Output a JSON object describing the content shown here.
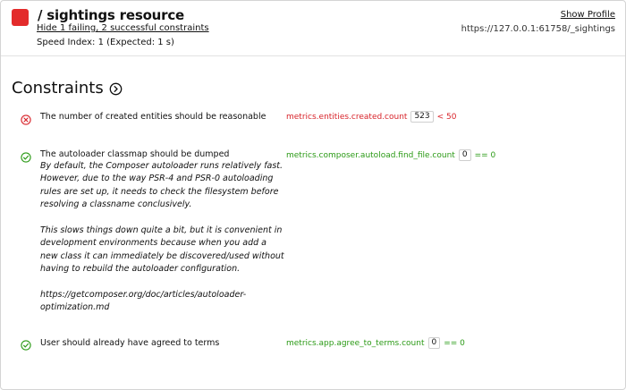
{
  "header": {
    "title": "/ sightings resource",
    "summary_link": "Hide 1 failing, 2 successful constraints",
    "speed_index": "Speed Index: 1 (Expected: 1 s)",
    "show_profile": "Show Profile",
    "url": "https://127.0.0.1:61758/_sightings",
    "status_color": "#e32b2b"
  },
  "section": {
    "title": "Constraints",
    "icon": "arrow-right-circle-icon"
  },
  "constraints": [
    {
      "status": "failed",
      "icon": "x-circle-icon",
      "label": "The number of created entities should be reasonable",
      "metric": "metrics.entities.created.count",
      "value": "523",
      "comparison": "< 50"
    },
    {
      "status": "passed",
      "icon": "check-circle-icon",
      "label": "The autoloader classmap should be dumped",
      "description": [
        "By default, the Composer autoloader runs relatively fast. However, due to the way PSR-4 and PSR-0 autoloading rules are set up, it needs to check the filesystem before resolving a classname conclusively.",
        "This slows things down quite a bit, but it is convenient in development environments because when you add a new class it can immediately be discovered/used without having to rebuild the autoloader configuration.",
        "https://getcomposer.org/doc/articles/autoloader-optimization.md"
      ],
      "metric": "metrics.composer.autoload.find_file.count",
      "value": "0",
      "comparison": "== 0"
    },
    {
      "status": "passed",
      "icon": "check-circle-icon",
      "label": "User should already have agreed to terms",
      "metric": "metrics.app.agree_to_terms.count",
      "value": "0",
      "comparison": "== 0"
    }
  ],
  "colors": {
    "failed": "#d8232a",
    "passed": "#2b9a16"
  }
}
